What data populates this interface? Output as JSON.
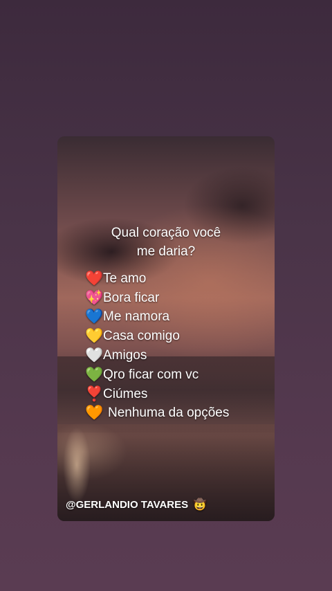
{
  "card": {
    "question_line1": "Qual coração você",
    "question_line2": "me daria?"
  },
  "options": [
    {
      "icon": "❤️",
      "icon_name": "red-heart-icon",
      "label": "Te amo"
    },
    {
      "icon": "💖",
      "icon_name": "sparkling-heart-icon",
      "label": "Bora ficar"
    },
    {
      "icon": "💙",
      "icon_name": "blue-heart-icon",
      "label": "Me namora"
    },
    {
      "icon": "💛",
      "icon_name": "yellow-heart-icon",
      "label": "Casa comigo"
    },
    {
      "icon": "🤍",
      "icon_name": "white-heart-icon",
      "label": "Amigos"
    },
    {
      "icon": "💚",
      "icon_name": "green-heart-icon",
      "label": "Qro ficar com vc"
    },
    {
      "icon": "❣️",
      "icon_name": "heart-exclamation-icon",
      "label": "Ciúmes"
    },
    {
      "icon": "🧡",
      "icon_name": "orange-heart-icon",
      "label": "Nenhuma da opções"
    }
  ],
  "watermark": {
    "text": "@GERLANDIO TAVARES",
    "icon": "🤠",
    "icon_name": "cowboy-face-icon"
  },
  "colors": {
    "background": "#4a3448",
    "text": "#ffffff"
  }
}
